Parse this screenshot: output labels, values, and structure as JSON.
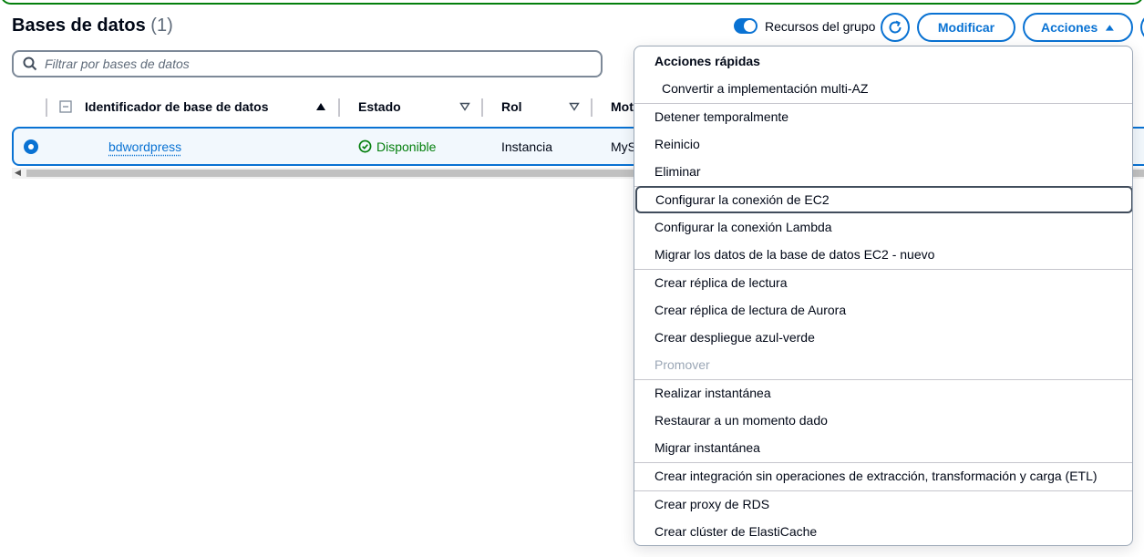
{
  "header": {
    "title": "Bases de datos",
    "count": "(1)",
    "toggle_label": "Recursos del grupo",
    "modify_label": "Modificar",
    "actions_label": "Acciones"
  },
  "search": {
    "placeholder": "Filtrar por bases de datos"
  },
  "table": {
    "columns": [
      "Identificador de base de datos",
      "Estado",
      "Rol",
      "Mot"
    ],
    "rows": [
      {
        "identifier": "bdwordpress",
        "status": "Disponible",
        "role": "Instancia",
        "engine": "MyS"
      }
    ]
  },
  "menu": {
    "group_title": "Acciones rápidas",
    "items": [
      "Convertir a implementación multi-AZ",
      "Detener temporalmente",
      "Reinicio",
      "Eliminar",
      "Configurar la conexión de EC2",
      "Configurar la conexión Lambda",
      "Migrar los datos de la base de datos EC2 - nuevo",
      "Crear réplica de lectura",
      "Crear réplica de lectura de Aurora",
      "Crear despliegue azul-verde",
      "Promover",
      "Realizar instantánea",
      "Restaurar a un momento dado",
      "Migrar instantánea",
      "Crear integración sin operaciones de extracción, transformación y carga (ETL)",
      "Crear proxy de RDS",
      "Crear clúster de ElastiCache"
    ]
  },
  "colors": {
    "accent": "#0972d3",
    "success": "#037f0c",
    "disabled": "#9ba7b6"
  },
  "icons": [
    "refresh-icon",
    "caret-up-icon",
    "search-icon",
    "sort-ascending-icon",
    "sort-descending-icon",
    "status-available-icon",
    "collapse-icon"
  ]
}
